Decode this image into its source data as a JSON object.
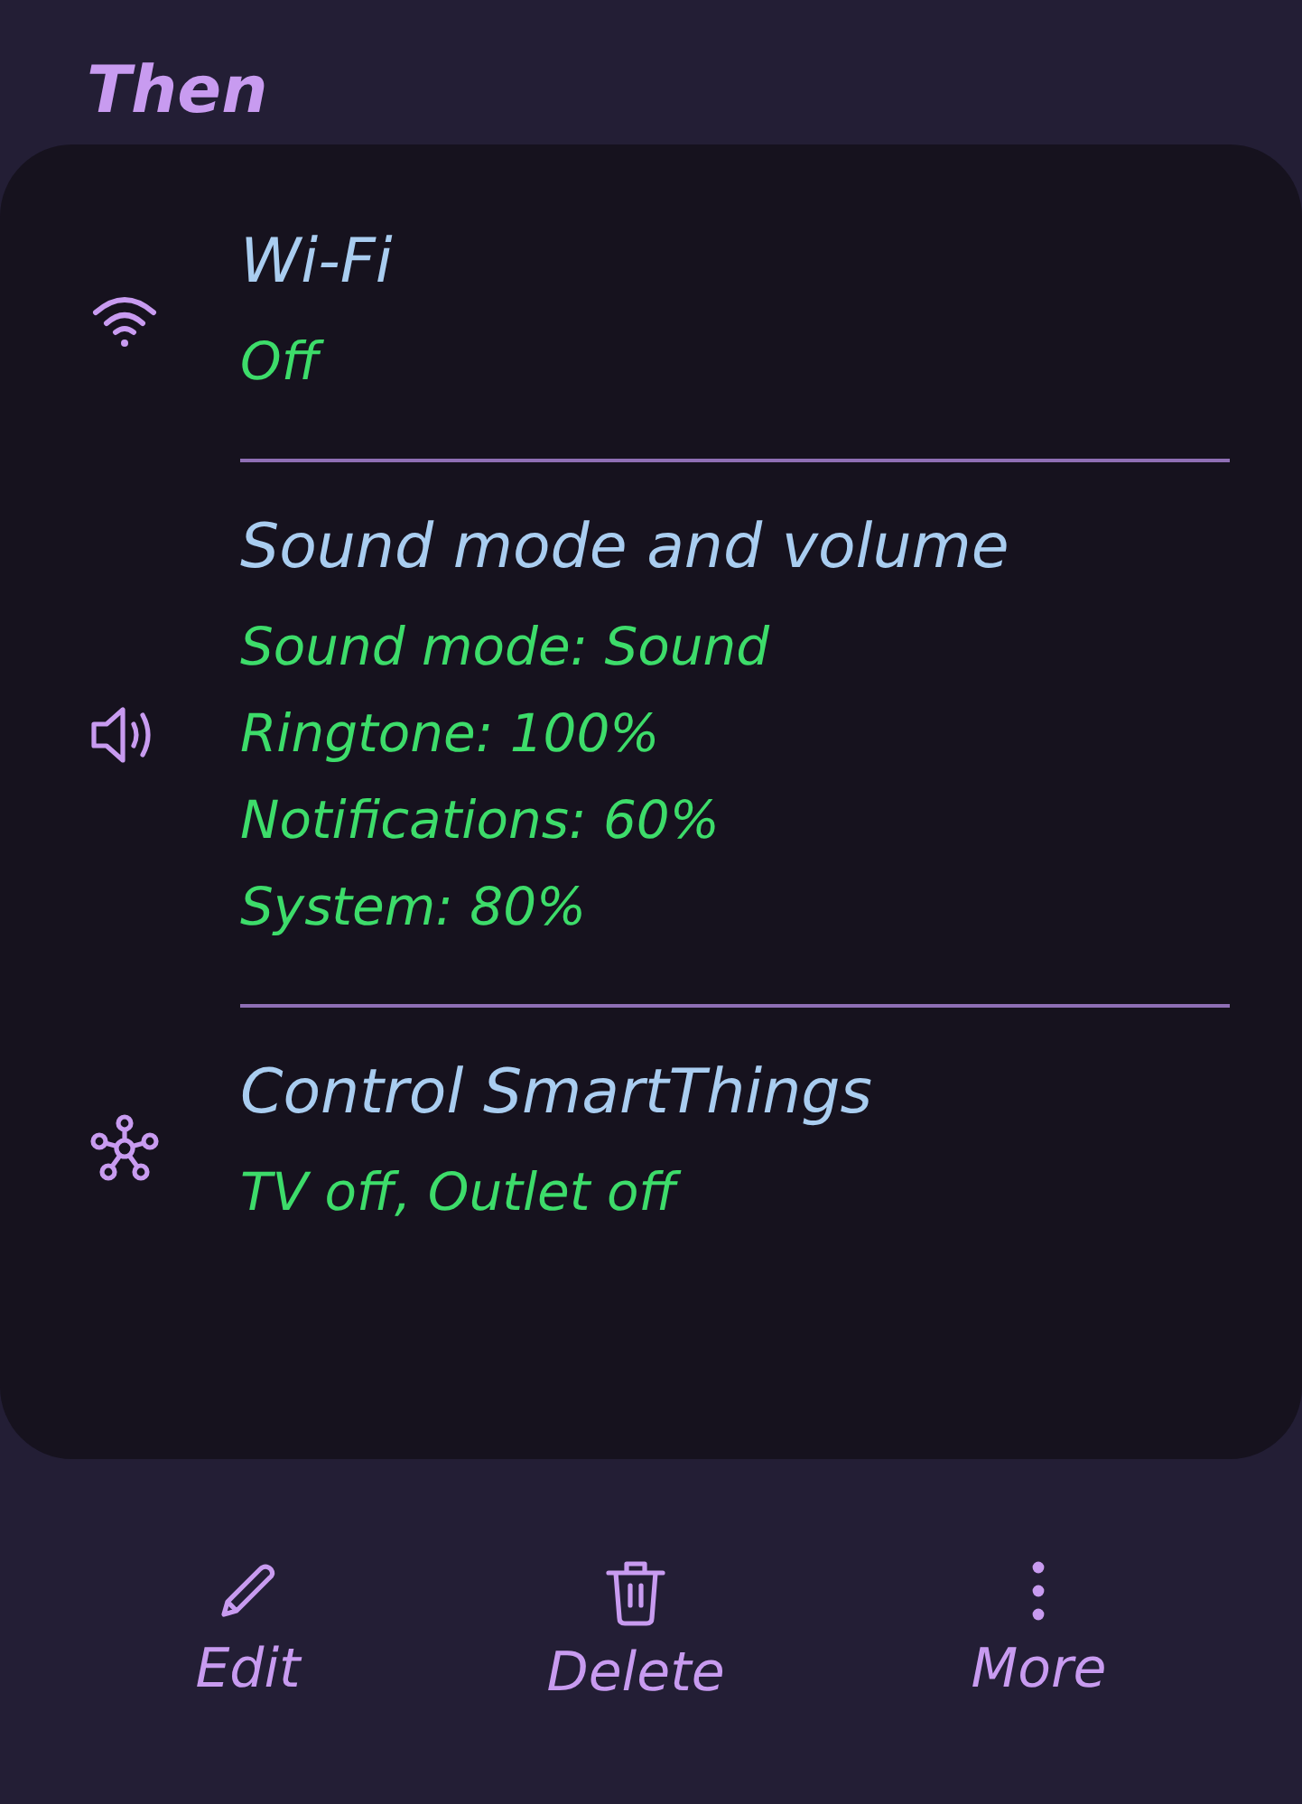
{
  "heading": "Then",
  "actions": [
    {
      "kind": "wifi",
      "title": "Wi-Fi",
      "details": [
        "Off"
      ]
    },
    {
      "kind": "sound",
      "title": "Sound mode and volume",
      "details": [
        "Sound mode: Sound",
        "Ringtone: 100%",
        "Notifications: 60%",
        "System: 80%"
      ]
    },
    {
      "kind": "smartthings",
      "title": "Control SmartThings",
      "details": [
        "TV off, Outlet off"
      ]
    }
  ],
  "toolbar": [
    {
      "kind": "edit",
      "label": "Edit"
    },
    {
      "kind": "delete",
      "label": "Delete"
    },
    {
      "kind": "more",
      "label": "More"
    }
  ]
}
